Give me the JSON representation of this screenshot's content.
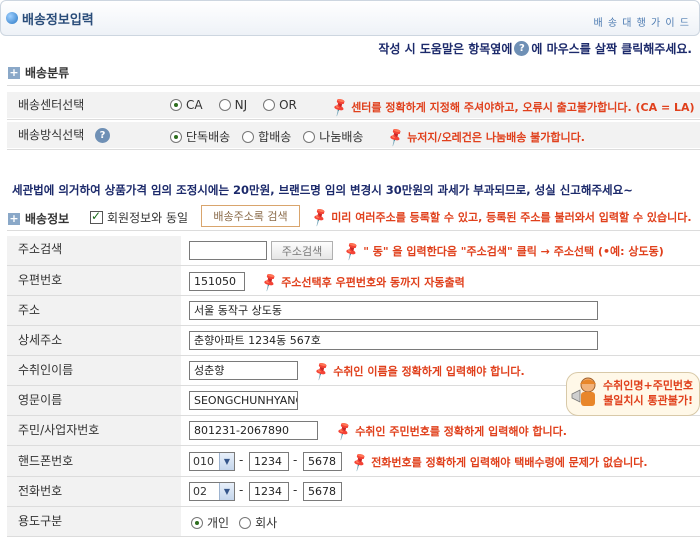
{
  "header": {
    "title": "배송정보입력",
    "guide_link": "배 송 대 행 가 이 드"
  },
  "help": {
    "text_before": "작성 시 도움말은 항목옆에",
    "icon": "?",
    "text_after": "에 마우스를 살짝 클릭해주세요."
  },
  "category_section": {
    "title": "배송분류",
    "center": {
      "label": "배송센터선택",
      "options": [
        "CA",
        "NJ",
        "OR"
      ],
      "selected": "CA",
      "note": "센터를 정확하게 지정해 주셔야하고, 오류시 출고불가합니다. (CA = LA)"
    },
    "method": {
      "label": "배송방식선택",
      "help_icon": "?",
      "options": [
        "단독배송",
        "합배송",
        "나눔배송"
      ],
      "selected": "단독배송",
      "note": "뉴저지/오레건은 나눔배송 불가합니다."
    }
  },
  "customs_warning": "세관법에 의거하여 상품가격 임의 조정시에는 20만원, 브랜드명 임의 변경시 30만원의 과세가 부과되므로, 성실 신고해주세요~",
  "shipping_section": {
    "title": "배송정보",
    "same_as_member_label": "회원정보와 동일",
    "same_as_member_checked": true,
    "address_book_button": "배송주소록 검색",
    "note": "미리 여러주소를 등록할 수 있고, 등록된 주소를 불러와서 입력할 수 있습니다."
  },
  "fields": {
    "address_search": {
      "label": "주소검색",
      "value": "",
      "button": "주소검색",
      "note": "\" 동\" 을 입력한다음 \"주소검색\" 클릭 → 주소선택 (•예: 상도동)"
    },
    "zipcode": {
      "label": "우편번호",
      "value": "151050",
      "note": "주소선택후 우편번호와 동까지 자동출력"
    },
    "address": {
      "label": "주소",
      "value": "서울 동작구 상도동"
    },
    "address_detail": {
      "label": "상세주소",
      "value": "춘향아파트 1234동 567호"
    },
    "recipient": {
      "label": "수취인이름",
      "value": "성춘향",
      "note": "수취인 이름을 정확하게 입력해야 합니다."
    },
    "english_name": {
      "label": "영문이름",
      "value": "SEONGCHUNHYANG"
    },
    "resident_id": {
      "label": "주민/사업자번호",
      "value": "801231-2067890",
      "note": "수취인 주민번호를 정확하게 입력해야 합니다."
    },
    "mobile": {
      "label": "핸드폰번호",
      "prefix": "010",
      "mid": "1234",
      "last": "5678",
      "note": "전화번호를 정확하게 입력해야 택배수령에 문제가 없습니다."
    },
    "phone": {
      "label": "전화번호",
      "prefix": "02",
      "mid": "1234",
      "last": "5678"
    },
    "usage": {
      "label": "용도구분",
      "options": [
        "개인",
        "회사"
      ],
      "selected": "개인"
    }
  },
  "callout": {
    "line1": "수취인명+주민번호",
    "line2": "불일치시 통관불가!"
  },
  "colors": {
    "note_red": "#e0401c",
    "navy_text": "#1c2a6b",
    "header_blue": "#2a4d7a",
    "row_gray": "#f2f2f2"
  }
}
